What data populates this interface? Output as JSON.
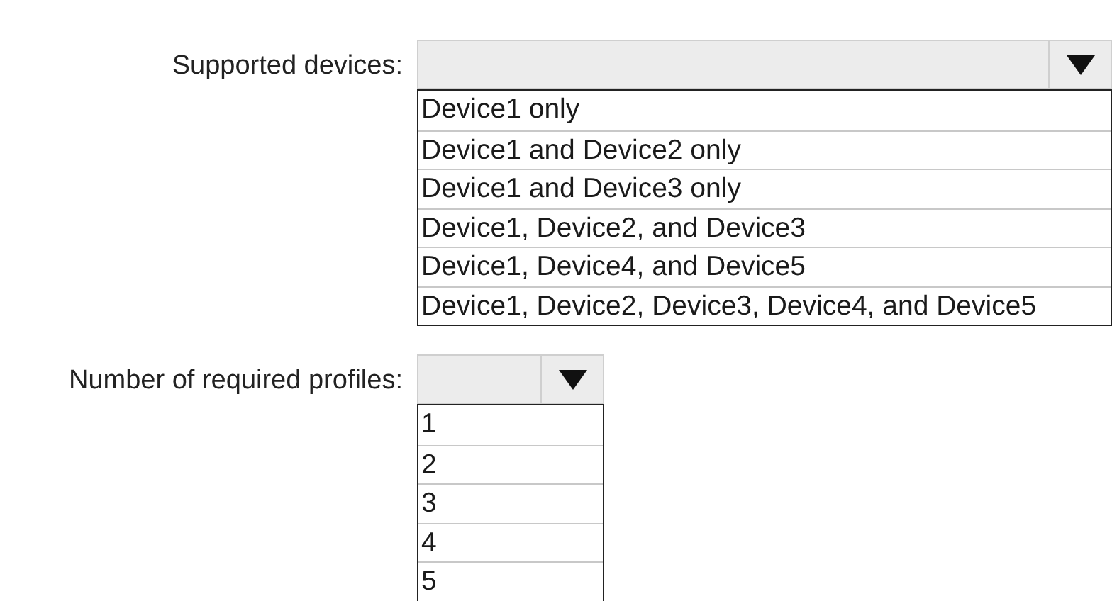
{
  "dropdowns": [
    {
      "label": "Supported devices:",
      "expanded": true,
      "options": [
        "Device1 only",
        "Device1 and Device2 only",
        "Device1 and Device3 only",
        "Device1, Device2, and Device3",
        "Device1, Device4, and Device5",
        "Device1, Device2, Device3, Device4, and Device5"
      ]
    },
    {
      "label": "Number of required profiles:",
      "expanded": true,
      "options": [
        "1",
        "2",
        "3",
        "4",
        "5"
      ]
    }
  ]
}
